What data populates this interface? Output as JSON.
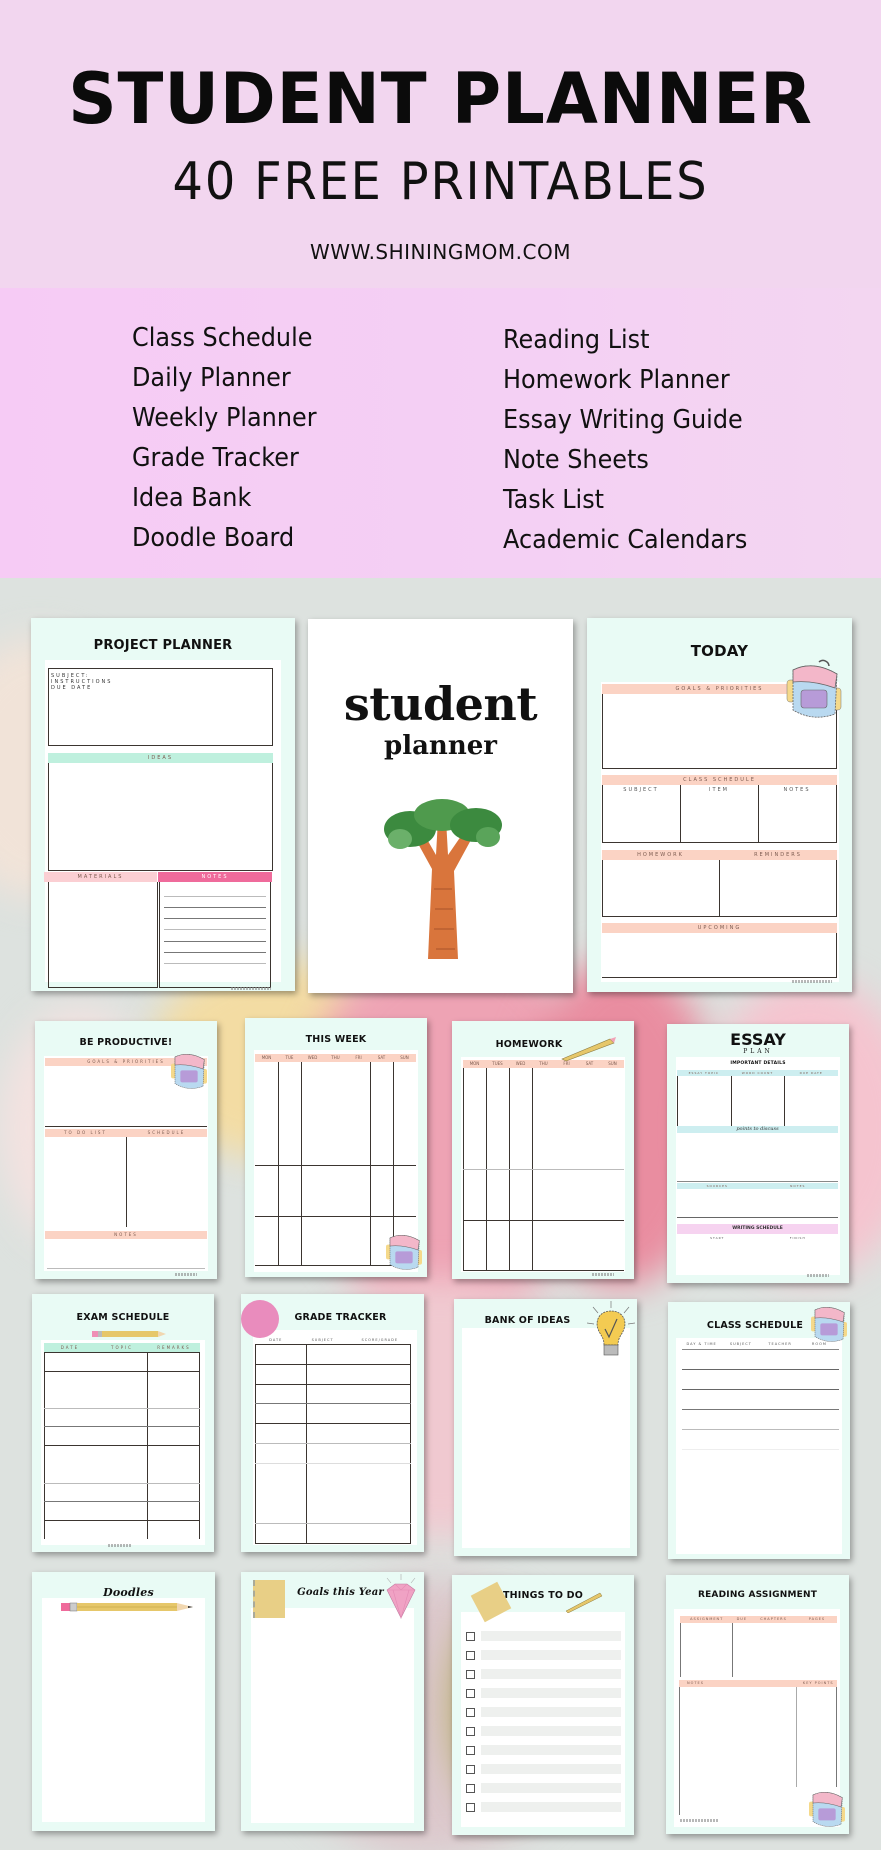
{
  "header": {
    "title": "STUDENT PLANNER",
    "subtitle": "40 FREE PRINTABLES",
    "website": "WWW.SHININGMOM.COM"
  },
  "contents": {
    "left": [
      "Class Schedule",
      "Daily Planner",
      "Weekly Planner",
      "Grade Tracker",
      "Idea Bank",
      "Doodle Board"
    ],
    "right": [
      "Reading List",
      "Homework Planner",
      "Essay Writing Guide",
      "Note Sheets",
      "Task List",
      "Academic Calendars"
    ]
  },
  "colors": {
    "header_bg": "#f2d6ef",
    "list_bg": "#f6cbf5",
    "page_bg": "#e9fbf5",
    "peach_header": "#fbd3c4",
    "mint_header": "#bff0de",
    "hot_pink": "#ef6b9b"
  },
  "pages": {
    "project_planner": {
      "title": "PROJECT PLANNER",
      "info_lines": [
        "SUBJECT:",
        "INSTRUCTIONS",
        "DUE DATE"
      ],
      "section_main": "IDEAS",
      "section_left": "MATERIALS",
      "section_right": "NOTES"
    },
    "cover": {
      "word1": "student",
      "word2": "planner",
      "illustration": "baobab-tree"
    },
    "today": {
      "title": "TODAY",
      "goals": "GOALS & PRIORITIES",
      "class_schedule": "CLASS SCHEDULE",
      "cols": [
        "SUBJECT",
        "ITEM",
        "NOTES"
      ],
      "homework": "HOMEWORK",
      "reminders": "REMINDERS",
      "upcoming": "UPCOMING"
    },
    "be_productive": {
      "title": "BE PRODUCTIVE!",
      "top": "GOALS & PRIORITIES",
      "left": "TO DO LIST",
      "right": "SCHEDULE",
      "bottom": "NOTES"
    },
    "this_week": {
      "title": "THIS WEEK",
      "days": [
        "MON",
        "TUE",
        "WED",
        "THU",
        "FRI",
        "SAT",
        "SUN"
      ]
    },
    "homework": {
      "title": "HOMEWORK",
      "days": [
        "MON",
        "TUES",
        "WED",
        "THU",
        "FRI",
        "SAT",
        "SUN"
      ]
    },
    "essay_plan": {
      "title": "ESSAY",
      "subtitle": "PLAN",
      "important": "IMPORTANT DETAILS",
      "cols": [
        "ESSAY TOPIC",
        "WORD COUNT",
        "DUE DATE"
      ],
      "points": "points to discuss",
      "row2": [
        "SOURCES",
        "NOTES"
      ],
      "writing": "WRITING SCHEDULE",
      "row3": [
        "START",
        "FINISH"
      ]
    },
    "exam_schedule": {
      "title": "EXAM SCHEDULE",
      "cols": [
        "DATE",
        "TOPIC",
        "REMARKS"
      ]
    },
    "grade_tracker": {
      "title": "GRADE TRACKER",
      "cols": [
        "DATE",
        "SUBJECT",
        "SCORE/GRADE"
      ]
    },
    "bank_of_ideas": {
      "title": "BANK OF IDEAS"
    },
    "class_schedule": {
      "title": "CLASS SCHEDULE",
      "cols": [
        "DAY & TIME",
        "SUBJECT",
        "TEACHER",
        "ROOM"
      ]
    },
    "doodles": {
      "title": "Doodles"
    },
    "goals_year": {
      "title": "Goals this Year"
    },
    "things_to_do": {
      "title": "THINGS TO DO"
    },
    "reading_assignment": {
      "title": "READING ASSIGNMENT",
      "cols": [
        "ASSIGNMENT",
        "DUE",
        "CHAPTERS",
        "PAGES"
      ],
      "row2": [
        "NOTES",
        "KEY POINTS"
      ]
    }
  }
}
